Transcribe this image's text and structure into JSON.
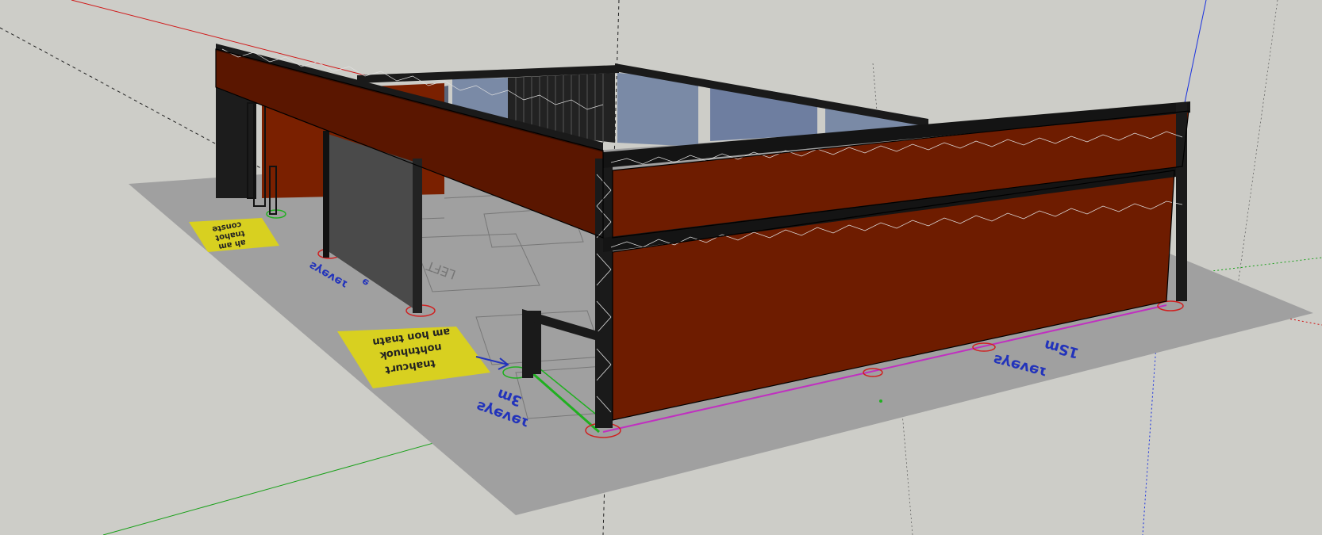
{
  "viewport": {
    "background": "#cdcdc8"
  },
  "axes": {
    "red_axis_color": "#d01818",
    "green_axis_color": "#18a018",
    "blue_axis_color": "#1830e0"
  },
  "colors": {
    "ground_plan": "#a0a0a0",
    "wall": "#6e1c00",
    "wall_dark": "#4e1400",
    "truss": "#1a1a1a",
    "glass": "#7a8aa6",
    "glass_dark": "#5a6478",
    "panel_gray": "#4a4a4a",
    "yellow_note": "#d8d020",
    "magenta_line": "#c030c0"
  },
  "plan_labels": {
    "dim_right_line1": "1Sm",
    "dim_right_line2": "ɿɘvɘγƨ",
    "dim_left_line1": "3m",
    "dim_left_line2": "ɿɘvɘγƨ",
    "dim_mid": "ɿɘvɘγƨ",
    "dim_mid2": "ɘ",
    "note_big_line1": "uʇɐuʇ uoɥ ɯɐ",
    "note_big_line2": "ʞonɥuʇɥou",
    "note_big_line3": "ʇɹnɔɥɐuʇ",
    "note_small_line1": "ǝʇsuoɔ",
    "note_small_line2": "ʇoɥɐuʇ",
    "note_small_line3": "ɯɐ ɥɐ",
    "plan_text_left": "LEFT"
  }
}
